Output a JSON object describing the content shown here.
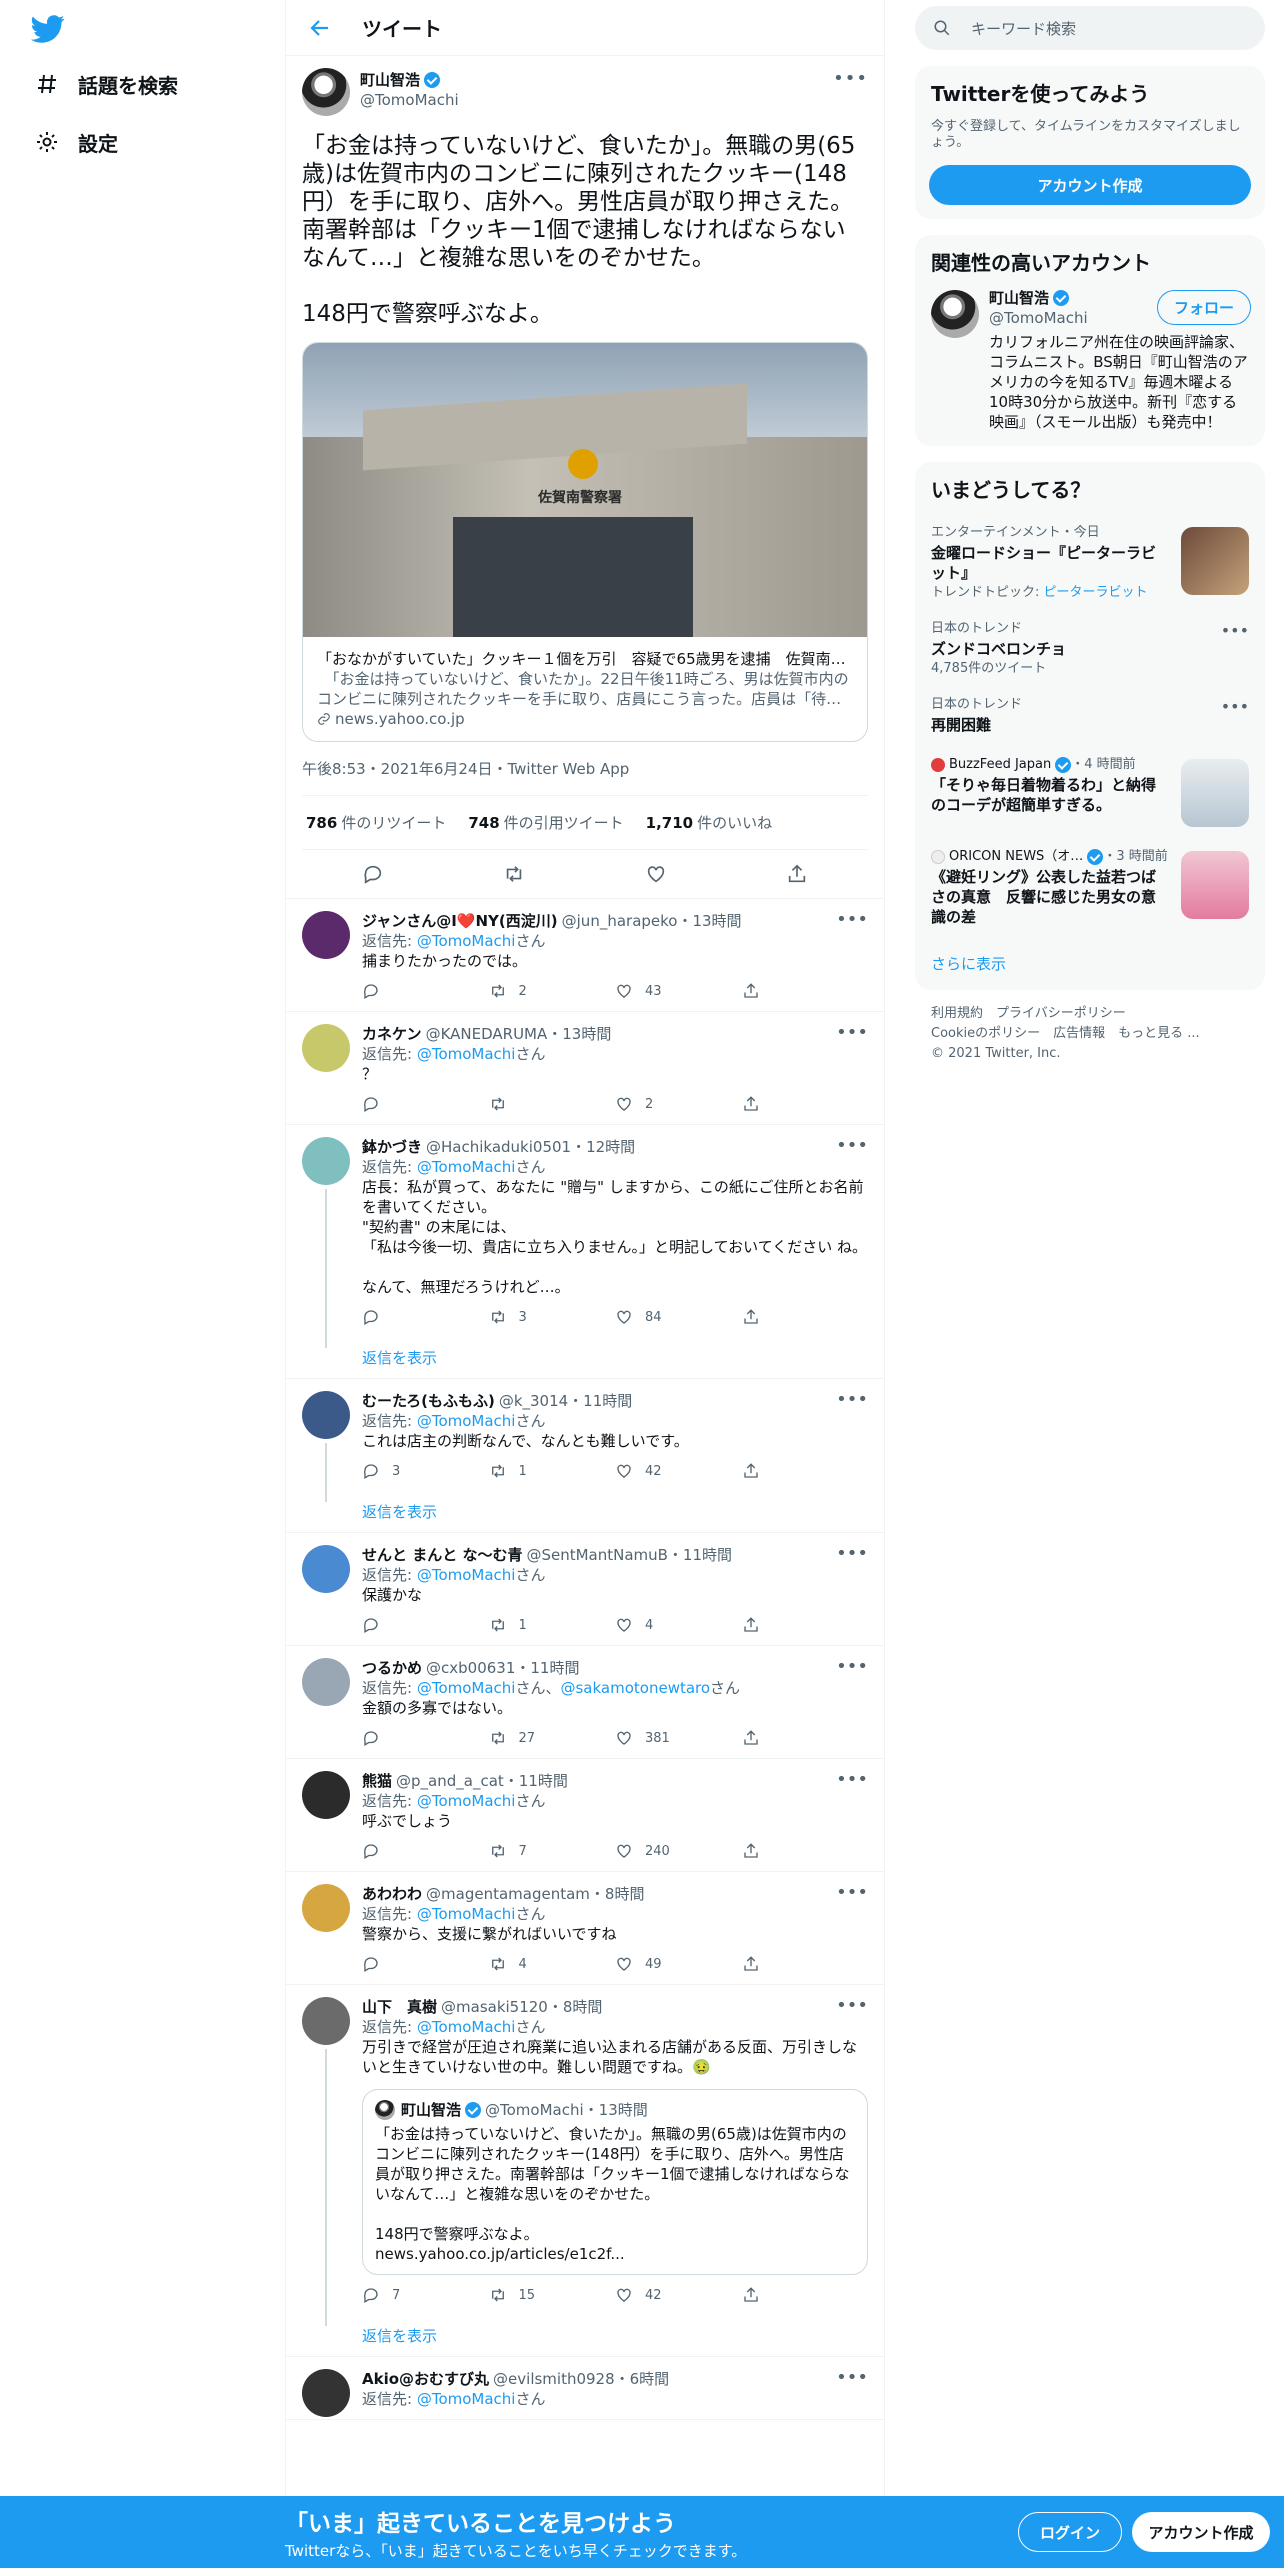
{
  "nav": {
    "logo": "twitter-bird-icon",
    "items": [
      {
        "label": "話題を検索",
        "icon": "hashtag-icon"
      },
      {
        "label": "設定",
        "icon": "gear-icon"
      }
    ]
  },
  "header": {
    "title": "ツイート"
  },
  "tweet": {
    "name": "町山智浩",
    "handle": "@TomoMachi",
    "text": "「お金は持っていないけど、食いたか」。無職の男(65歳)は佐賀市内のコンビニに陳列されたクッキー(148円）を手に取り、店外へ。男性店員が取り押さえた。南署幹部は「クッキー1個で逮捕しなければならないなんて…」と複雑な思いをのぞかせた。\n\n148円で警察呼ぶなよ。",
    "card": {
      "image_sign": "佐賀南警察署",
      "title": "「おなかがすいていた」クッキー１個を万引　容疑で65歳男を逮捕　佐賀南…",
      "description": "　「お金は持っていないけど、食いたか」。22日午後11時ごろ、男は佐賀市内のコンビニに陳列されたクッキーを手に取り、店員にこう言った。店員は「待…",
      "domain": "news.yahoo.co.jp"
    },
    "meta": "午後8:53・2021年6月24日・Twitter Web App",
    "stats": {
      "retweets": "786",
      "retweets_label": "件のリツイート",
      "quotes": "748",
      "quotes_label": "件の引用ツイート",
      "likes": "1,710",
      "likes_label": "件のいいね"
    }
  },
  "replies": [
    {
      "name": "ジャンさん@I❤️NY(西淀川)",
      "handle": "@jun_harapeko・13時間",
      "to": "返信先: ",
      "mention": "@TomoMachi",
      "suffix": "さん",
      "text": "捕まりたかったのでは。",
      "reply_count": "",
      "rt_count": "2",
      "like_count": "43",
      "show_more": "",
      "color": "#5a2a6a"
    },
    {
      "name": "カネケン",
      "handle": "@KANEDARUMA・13時間",
      "to": "返信先: ",
      "mention": "@TomoMachi",
      "suffix": "さん",
      "text": "？",
      "reply_count": "",
      "rt_count": "",
      "like_count": "2",
      "show_more": "",
      "color": "#c7c86a"
    },
    {
      "name": "鉢かづき",
      "handle": "@Hachikaduki0501・12時間",
      "to": "返信先: ",
      "mention": "@TomoMachi",
      "suffix": "さん",
      "text": "店長：私が買って、あなたに \"贈与\" しますから、この紙にご住所とお名前を書いてください。\n\"契約書\" の末尾には、\n「私は今後一切、貴店に立ち入りません。」と明記しておいてください ね。\n\nなんて、無理だろうけれど…。",
      "reply_count": "",
      "rt_count": "3",
      "like_count": "84",
      "show_more": "返信を表示",
      "color": "#7fbfc0"
    },
    {
      "name": "むーたろ(もふもふ)",
      "handle": "@k_3014・11時間",
      "to": "返信先: ",
      "mention": "@TomoMachi",
      "suffix": "さん",
      "text": "これは店主の判断なんで、なんとも難しいです。",
      "reply_count": "3",
      "rt_count": "1",
      "like_count": "42",
      "show_more": "返信を表示",
      "color": "#3b5a8a"
    },
    {
      "name": "せんと まんと な〜む青",
      "handle": "@SentMantNamuB・11時間",
      "to": "返信先: ",
      "mention": "@TomoMachi",
      "suffix": "さん",
      "text": "保護かな",
      "reply_count": "",
      "rt_count": "1",
      "like_count": "4",
      "show_more": "",
      "color": "#4a8ad0"
    },
    {
      "name": "つるかめ",
      "handle": "@cxb00631・11時間",
      "to": "返信先: ",
      "mention": "@TomoMachi",
      "suffix": "さん、",
      "mention2": "@sakamotonewtaro",
      "suffix2": "さん",
      "text": "金額の多寡ではない。",
      "reply_count": "",
      "rt_count": "27",
      "like_count": "381",
      "show_more": "",
      "color": "#99a6b4"
    },
    {
      "name": "熊猫",
      "handle": "@p_and_a_cat・11時間",
      "to": "返信先: ",
      "mention": "@TomoMachi",
      "suffix": "さん",
      "text": "呼ぶでしょう",
      "reply_count": "",
      "rt_count": "7",
      "like_count": "240",
      "show_more": "",
      "color": "#2b2b2b"
    },
    {
      "name": "あわわわ",
      "handle": "@magentamagentam・8時間",
      "to": "返信先: ",
      "mention": "@TomoMachi",
      "suffix": "さん",
      "text": "警察から、支援に繋がればいいですね",
      "reply_count": "",
      "rt_count": "4",
      "like_count": "49",
      "show_more": "",
      "color": "#d6a640"
    },
    {
      "name": "山下　真樹",
      "handle": "@masaki5120・8時間",
      "to": "返信先: ",
      "mention": "@TomoMachi",
      "suffix": "さん",
      "text": "万引きで経営が圧迫され廃業に追い込まれる店舗がある反面、万引きしないと生きていけない世の中。難しい問題ですね。🤢",
      "reply_count": "7",
      "rt_count": "15",
      "like_count": "42",
      "show_more": "返信を表示",
      "color": "#6b6b6b",
      "quote": {
        "name": "町山智浩",
        "handle": "@TomoMachi・13時間",
        "text": "「お金は持っていないけど、食いたか」。無職の男(65歳)は佐賀市内のコンビニに陳列されたクッキー(148円）を手に取り、店外へ。男性店員が取り押さえた。南署幹部は「クッキー1個で逮捕しなければならないなんて…」と複雑な思いをのぞかせた。\n\n148円で警察呼ぶなよ。\nnews.yahoo.co.jp/articles/e1c2f..."
      }
    },
    {
      "name": "Akio@おむすび丸",
      "handle": "@evilsmith0928・6時間",
      "to": "返信先: ",
      "mention": "@TomoMachi",
      "suffix": "さん",
      "text": "",
      "reply_count": "",
      "rt_count": "",
      "like_count": "",
      "show_more": "",
      "color": "#333"
    }
  ],
  "sidebar": {
    "search_placeholder": "キーワード検索",
    "signup": {
      "title": "Twitterを使ってみよう",
      "text": "今すぐ登録して、タイムラインをカスタマイズしましょう。",
      "button": "アカウント作成"
    },
    "related": {
      "title": "関連性の高いアカウント",
      "name": "町山智浩",
      "handle": "@TomoMachi",
      "follow": "フォロー",
      "bio": "カリフォルニア州在住の映画評論家、コラムニスト。BS朝日『町山智浩のアメリカの今を知るTV』毎週木曜よる10時30分から放送中。新刊『恋する映画』（スモール出版）も発売中！"
    },
    "trends": {
      "title": "いまどうしてる？",
      "items": [
        {
          "context": "エンターテインメント・今日",
          "title": "金曜ロードショー『ピーターラビット』",
          "extra_label": "トレンドトピック: ",
          "extra_link": "ピーターラビット",
          "thumb": "#6b4a3a"
        },
        {
          "context": "日本のトレンド",
          "title": "ズンドコベロンチョ",
          "extra_label": "4,785件のツイート",
          "extra_link": ""
        },
        {
          "context": "日本のトレンド",
          "title": "再開困難",
          "extra_label": "",
          "extra_link": ""
        },
        {
          "source": "BuzzFeed Japan",
          "time": "・4 時間前",
          "title": "「そりゃ毎日着物着るわ」と納得のコーデが超簡単すぎる。",
          "thumb": "#c8d4dc",
          "src_color": "#e23c3c"
        },
        {
          "source": "ORICON NEWS（オ…",
          "time": "・3 時間前",
          "title": "《避妊リング》公表した益若つばさの真意　反響に感じた男女の意識の差",
          "thumb": "#e8b8c8",
          "src_color": "#ffffff"
        }
      ],
      "more": "さらに表示"
    },
    "footer": "利用規約　プライバシーポリシー\nCookieのポリシー　広告情報　もっと見る ...\n© 2021 Twitter, Inc."
  },
  "banner": {
    "title": "「いま」起きていることを見つけよう",
    "subtitle": "Twitterなら、「いま」起きていることをいち早くチェックできます。",
    "login": "ログイン",
    "signup": "アカウント作成"
  },
  "colors": {
    "accent": "#1d9bf0",
    "text": "#0f1419",
    "muted": "#536471"
  }
}
